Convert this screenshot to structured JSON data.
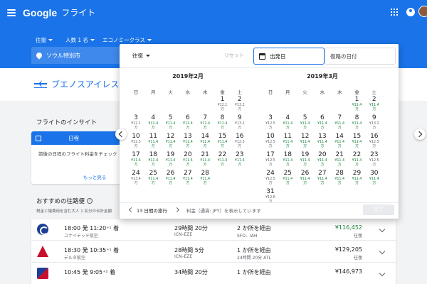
{
  "appbar": {
    "brand": "Google",
    "product": "フライト"
  },
  "search": {
    "trip_type": "往復",
    "passengers": "人数 1 名",
    "cabin": "エコノミークラス",
    "origin": "ソウル特別市"
  },
  "destination": {
    "title": "ブエノスアイレスへの"
  },
  "insights": {
    "title": "フライトのインサイト",
    "card_label": "日程",
    "body": "前後の日程のフライト料金をチェック",
    "link": "もっと見る"
  },
  "recommended": {
    "title": "おすすめの往路便",
    "note": "税金と諸費用を含む大人 1 名分の合計金額"
  },
  "flights": [
    {
      "time": "18:00 発 11:20⁺¹ 着",
      "airline": "ユナイテッド航空",
      "duration": "29時間 20分",
      "route": "ICN–EZE",
      "stops": "2 か所を経由",
      "via": "SFO、IAH",
      "price": "¥116,452",
      "trip": "往復",
      "price_color": "#188038"
    },
    {
      "time": "18:30 発 10:35⁺¹ 着",
      "airline": "デルタ航空",
      "duration": "28時間 5分",
      "route": "ICN–EZE",
      "stops": "1 か所を経由",
      "via": "24時間 20分 ATL",
      "price": "¥129,205",
      "trip": "往復",
      "price_color": "#202124"
    },
    {
      "time": "10:45 発 9:05⁺¹ 着",
      "airline": "",
      "duration": "34時間 20分",
      "route": "",
      "stops": "1 か所を経由",
      "via": "",
      "price": "¥146,973",
      "trip": "",
      "price_color": "#202124"
    }
  ],
  "date_picker": {
    "trip_type": "往復",
    "reset": "リセット",
    "depart": "出発日",
    "return": "復路の日付",
    "weekdays": [
      "日",
      "月",
      "火",
      "水",
      "木",
      "金",
      "土"
    ],
    "duration": "13 日間の旅行",
    "fare_note": "料金（通貨: JPY）を表示しています",
    "done": "完了",
    "months": [
      {
        "title": "2019年2月",
        "days": [
          {
            "num": "1",
            "col": 5,
            "row": 0,
            "p1": "¥12.1",
            "p2": "万",
            "low": false
          },
          {
            "num": "2",
            "col": 6,
            "row": 0,
            "p1": "¥13.2",
            "p2": "万",
            "low": false
          },
          {
            "num": "3",
            "col": 0,
            "row": 1,
            "p1": "¥12.1",
            "p2": "万",
            "low": false
          },
          {
            "num": "4",
            "col": 1,
            "row": 1,
            "p1": "¥11.4",
            "p2": "万",
            "low": true
          },
          {
            "num": "5",
            "col": 2,
            "row": 1,
            "p1": "¥11.4",
            "p2": "万",
            "low": true
          },
          {
            "num": "6",
            "col": 3,
            "row": 1,
            "p1": "¥11.4",
            "p2": "万",
            "low": true
          },
          {
            "num": "7",
            "col": 4,
            "row": 1,
            "p1": "¥11.4",
            "p2": "万",
            "low": true
          },
          {
            "num": "8",
            "col": 5,
            "row": 1,
            "p1": "¥11.4",
            "p2": "万",
            "low": true
          },
          {
            "num": "9",
            "col": 6,
            "row": 1,
            "p1": "¥13.2",
            "p2": "万",
            "low": false
          },
          {
            "num": "10",
            "col": 0,
            "row": 2,
            "p1": "¥12.5",
            "p2": "万",
            "low": false
          },
          {
            "num": "11",
            "col": 1,
            "row": 2,
            "p1": "¥11.4",
            "p2": "万",
            "low": true
          },
          {
            "num": "12",
            "col": 2,
            "row": 2,
            "p1": "¥11.4",
            "p2": "万",
            "low": true
          },
          {
            "num": "13",
            "col": 3,
            "row": 2,
            "p1": "¥11.4",
            "p2": "万",
            "low": true
          },
          {
            "num": "14",
            "col": 4,
            "row": 2,
            "p1": "¥11.4",
            "p2": "万",
            "low": true
          },
          {
            "num": "15",
            "col": 5,
            "row": 2,
            "p1": "¥11.4",
            "p2": "万",
            "low": true
          },
          {
            "num": "16",
            "col": 6,
            "row": 2,
            "p1": "¥12.5",
            "p2": "万",
            "low": false
          },
          {
            "num": "17",
            "col": 0,
            "row": 3,
            "p1": "¥11.4",
            "p2": "万",
            "low": true
          },
          {
            "num": "18",
            "col": 1,
            "row": 3,
            "p1": "¥11.4",
            "p2": "万",
            "low": true
          },
          {
            "num": "19",
            "col": 2,
            "row": 3,
            "p1": "¥11.4",
            "p2": "万",
            "low": true
          },
          {
            "num": "20",
            "col": 3,
            "row": 3,
            "p1": "¥11.4",
            "p2": "万",
            "low": true
          },
          {
            "num": "21",
            "col": 4,
            "row": 3,
            "p1": "¥11.4",
            "p2": "万",
            "low": true
          },
          {
            "num": "22",
            "col": 5,
            "row": 3,
            "p1": "¥11.4",
            "p2": "万",
            "low": true
          },
          {
            "num": "23",
            "col": 6,
            "row": 3,
            "p1": "¥11.4",
            "p2": "万",
            "low": true
          },
          {
            "num": "24",
            "col": 0,
            "row": 4,
            "p1": "¥13.4",
            "p2": "万",
            "low": false
          },
          {
            "num": "25",
            "col": 1,
            "row": 4,
            "p1": "¥11.4",
            "p2": "万",
            "low": true
          },
          {
            "num": "26",
            "col": 2,
            "row": 4,
            "p1": "¥11.4",
            "p2": "万",
            "low": true
          },
          {
            "num": "27",
            "col": 3,
            "row": 4,
            "p1": "¥11.4",
            "p2": "万",
            "low": true
          },
          {
            "num": "28",
            "col": 4,
            "row": 4,
            "p1": "¥11.4",
            "p2": "万",
            "low": true
          }
        ]
      },
      {
        "title": "2019年3月",
        "days": [
          {
            "num": "1",
            "col": 5,
            "row": 0,
            "p1": "¥11.4",
            "p2": "万",
            "low": true
          },
          {
            "num": "2",
            "col": 6,
            "row": 0,
            "p1": "¥11.4",
            "p2": "万",
            "low": true
          },
          {
            "num": "3",
            "col": 0,
            "row": 1,
            "p1": "¥12.5",
            "p2": "万",
            "low": false
          },
          {
            "num": "4",
            "col": 1,
            "row": 1,
            "p1": "¥11.4",
            "p2": "万",
            "low": true
          },
          {
            "num": "5",
            "col": 2,
            "row": 1,
            "p1": "¥11.4",
            "p2": "万",
            "low": true
          },
          {
            "num": "6",
            "col": 3,
            "row": 1,
            "p1": "¥11.4",
            "p2": "万",
            "low": true
          },
          {
            "num": "7",
            "col": 4,
            "row": 1,
            "p1": "¥11.4",
            "p2": "万",
            "low": true
          },
          {
            "num": "8",
            "col": 5,
            "row": 1,
            "p1": "¥11.4",
            "p2": "万",
            "low": true
          },
          {
            "num": "9",
            "col": 6,
            "row": 1,
            "p1": "¥13.2",
            "p2": "万",
            "low": false
          },
          {
            "num": "10",
            "col": 0,
            "row": 2,
            "p1": "¥12.5",
            "p2": "万",
            "low": false
          },
          {
            "num": "11",
            "col": 1,
            "row": 2,
            "p1": "¥11.4",
            "p2": "万",
            "low": true
          },
          {
            "num": "12",
            "col": 2,
            "row": 2,
            "p1": "¥11.4",
            "p2": "万",
            "low": true
          },
          {
            "num": "13",
            "col": 3,
            "row": 2,
            "p1": "¥11.4",
            "p2": "万",
            "low": true
          },
          {
            "num": "14",
            "col": 4,
            "row": 2,
            "p1": "¥11.4",
            "p2": "万",
            "low": true
          },
          {
            "num": "15",
            "col": 5,
            "row": 2,
            "p1": "¥11.4",
            "p2": "万",
            "low": true
          },
          {
            "num": "16",
            "col": 6,
            "row": 2,
            "p1": "¥12.5",
            "p2": "万",
            "low": false
          },
          {
            "num": "17",
            "col": 0,
            "row": 3,
            "p1": "¥12.5",
            "p2": "万",
            "low": false
          },
          {
            "num": "18",
            "col": 1,
            "row": 3,
            "p1": "¥11.4",
            "p2": "万",
            "low": true
          },
          {
            "num": "19",
            "col": 2,
            "row": 3,
            "p1": "¥11.4",
            "p2": "万",
            "low": true
          },
          {
            "num": "20",
            "col": 3,
            "row": 3,
            "p1": "¥11.4",
            "p2": "万",
            "low": true
          },
          {
            "num": "21",
            "col": 4,
            "row": 3,
            "p1": "¥11.4",
            "p2": "万",
            "low": true
          },
          {
            "num": "22",
            "col": 5,
            "row": 3,
            "p1": "¥11.4",
            "p2": "万",
            "low": true
          },
          {
            "num": "23",
            "col": 6,
            "row": 3,
            "p1": "¥12.5",
            "p2": "万",
            "low": false
          },
          {
            "num": "24",
            "col": 0,
            "row": 4,
            "p1": "¥12.5",
            "p2": "万",
            "low": false
          },
          {
            "num": "25",
            "col": 1,
            "row": 4,
            "p1": "¥11.4",
            "p2": "万",
            "low": true
          },
          {
            "num": "26",
            "col": 2,
            "row": 4,
            "p1": "¥11.4",
            "p2": "万",
            "low": true
          },
          {
            "num": "27",
            "col": 3,
            "row": 4,
            "p1": "¥11.4",
            "p2": "万",
            "low": true
          },
          {
            "num": "28",
            "col": 4,
            "row": 4,
            "p1": "¥11.4",
            "p2": "万",
            "low": true
          },
          {
            "num": "29",
            "col": 5,
            "row": 4,
            "p1": "¥11.4",
            "p2": "万",
            "low": true
          },
          {
            "num": "30",
            "col": 6,
            "row": 4,
            "p1": "¥11.4",
            "p2": "万",
            "low": true
          },
          {
            "num": "31",
            "col": 0,
            "row": 5,
            "p1": "¥12.6",
            "p2": "万",
            "low": false
          }
        ]
      }
    ]
  }
}
